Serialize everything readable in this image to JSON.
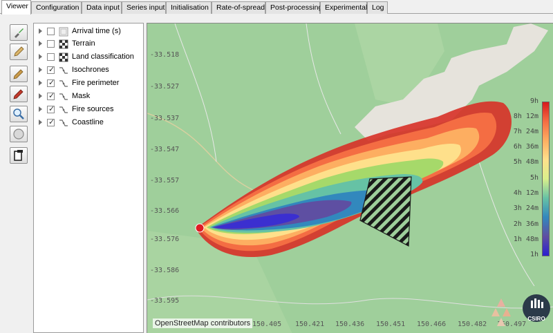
{
  "tabs": [
    {
      "label": "Viewer",
      "active": true
    },
    {
      "label": "Configuration"
    },
    {
      "label": "Data input"
    },
    {
      "label": "Series input"
    },
    {
      "label": "Initialisation"
    },
    {
      "label": "Rate-of-spread"
    },
    {
      "label": "Post-processing"
    },
    {
      "label": "Experimental"
    },
    {
      "label": "Log"
    }
  ],
  "tools": [
    {
      "icon": "brush-icon"
    },
    {
      "icon": "pencil-icon"
    },
    {
      "icon": "pencil-icon"
    },
    {
      "icon": "red-pencil-icon"
    },
    {
      "icon": "zoom-icon"
    },
    {
      "icon": "circle-icon"
    },
    {
      "icon": "export-icon"
    }
  ],
  "layers": [
    {
      "label": "Arrival time (s)",
      "checked": false,
      "icon": "raster-icon"
    },
    {
      "label": "Terrain",
      "checked": false,
      "icon": "checker-icon"
    },
    {
      "label": "Land classification",
      "checked": false,
      "icon": "checker-icon"
    },
    {
      "label": "Isochrones",
      "checked": true,
      "icon": "line-icon"
    },
    {
      "label": "Fire perimeter",
      "checked": true,
      "icon": "line-icon"
    },
    {
      "label": "Mask",
      "checked": true,
      "icon": "line-icon"
    },
    {
      "label": "Fire sources",
      "checked": true,
      "icon": "line-icon"
    },
    {
      "label": "Coastline",
      "checked": true,
      "icon": "line-icon"
    }
  ],
  "map": {
    "y_ticks": [
      "-33.518",
      "-33.527",
      "-33.537",
      "-33.547",
      "-33.557",
      "-33.566",
      "-33.576",
      "-33.586",
      "-33.595"
    ],
    "x_ticks": [
      "150.405",
      "150.421",
      "150.436",
      "150.451",
      "150.466",
      "150.482",
      "150.497"
    ],
    "attribution": "OpenStreetMap contributors",
    "legend": [
      "9h",
      "8h 12m",
      "7h 24m",
      "6h 36m",
      "5h 48m",
      "5h",
      "4h 12m",
      "3h 24m",
      "2h 36m",
      "1h 48m",
      "1h"
    ],
    "logo": "CSIRO"
  }
}
